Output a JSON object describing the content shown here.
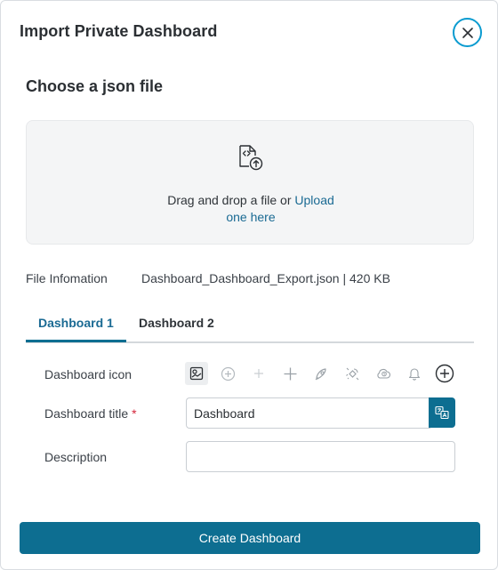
{
  "dialog": {
    "title": "Import Private Dashboard",
    "close_icon": "close-icon"
  },
  "file_section": {
    "heading": "Choose a json file",
    "dropzone_icon": "file-code-upload-icon",
    "drop_text": "Drag and drop a file or ",
    "upload_link_line1": "Upload",
    "upload_link_line2": "one here"
  },
  "file_info": {
    "label": "File Infomation",
    "value": "Dashboard_Dashboard_Export.json | 420 KB"
  },
  "tabs": [
    {
      "label": "Dashboard 1",
      "active": true
    },
    {
      "label": "Dashboard 2",
      "active": false
    }
  ],
  "form": {
    "icon_label": "Dashboard icon",
    "icon_options": [
      "dashboard-chart-icon",
      "plus-circle-icon",
      "plus-small-icon",
      "plus-icon",
      "rocket-icon",
      "satellite-icon",
      "alarm-cloud-icon",
      "bell-icon",
      "add-circle-icon"
    ],
    "selected_icon": "dashboard-chart-icon",
    "title_label": "Dashboard title",
    "required_mark": "*",
    "title_value": "Dashboard",
    "translate_icon": "translate-icon",
    "description_label": "Description",
    "description_value": ""
  },
  "footer": {
    "create_label": "Create Dashboard"
  },
  "colors": {
    "primary": "#0d6e91",
    "link": "#1a6a93",
    "close_ring": "#0a9bd0",
    "required": "#d4253a"
  }
}
